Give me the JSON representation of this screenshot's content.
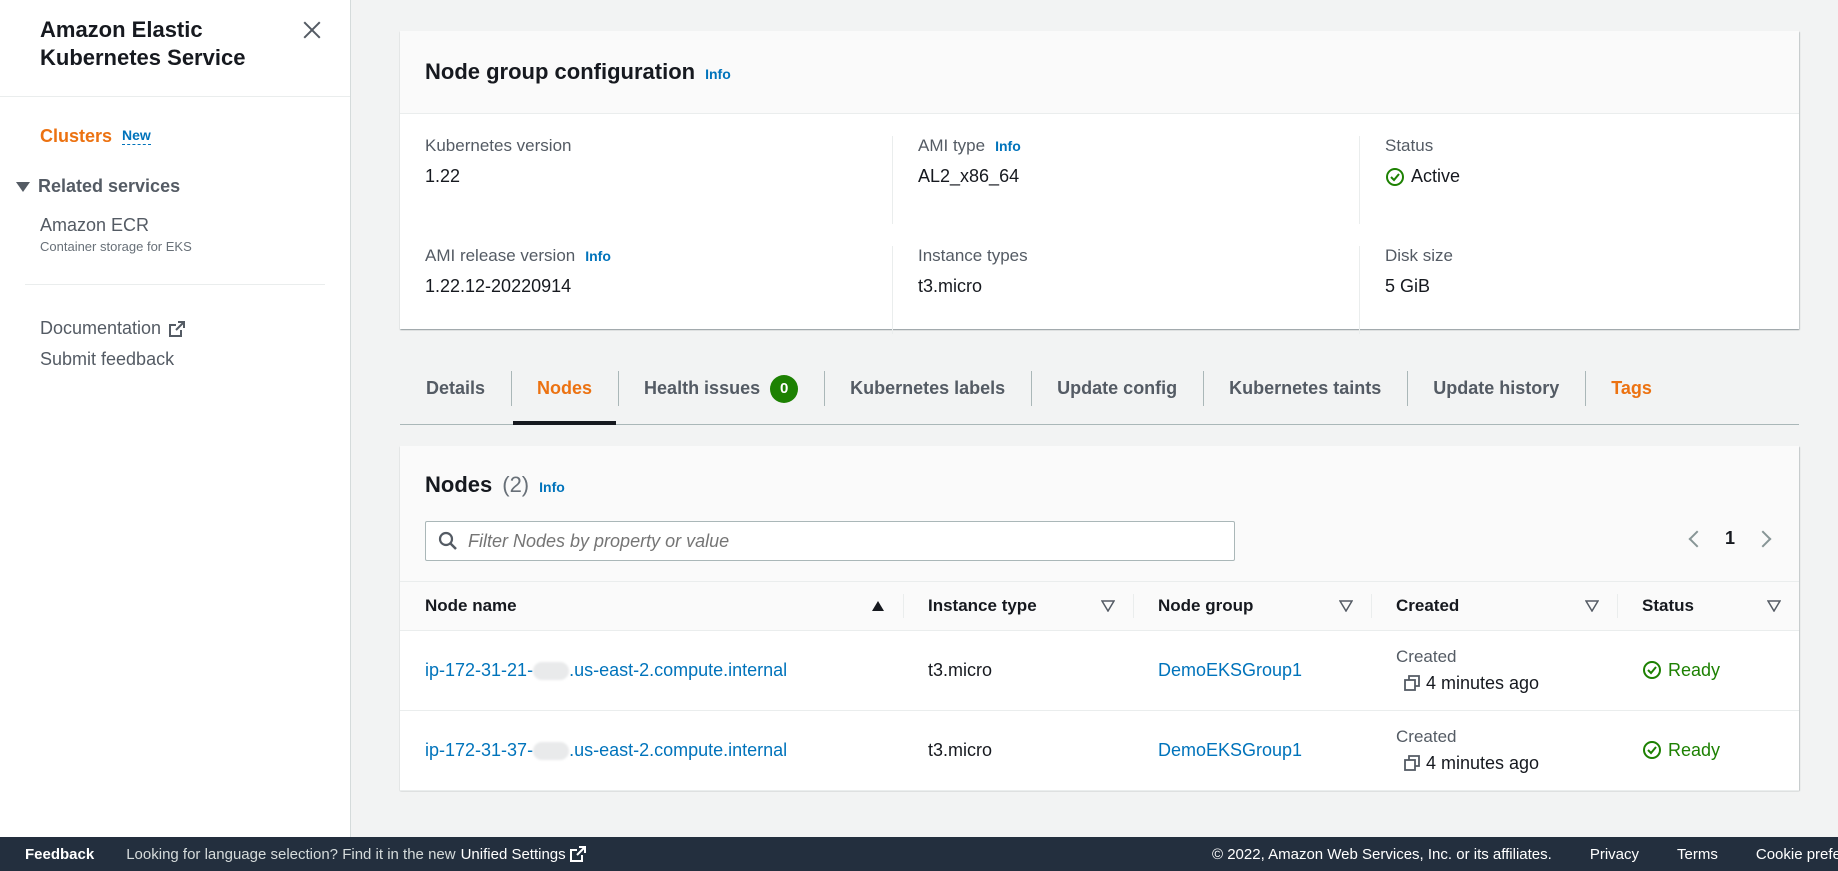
{
  "sidebar": {
    "title": "Amazon Elastic Kubernetes Service",
    "clusters_label": "Clusters",
    "clusters_badge": "New",
    "related_label": "Related services",
    "ecr_title": "Amazon ECR",
    "ecr_sub": "Container storage for EKS",
    "documentation": "Documentation",
    "feedback": "Submit feedback"
  },
  "config": {
    "title": "Node group configuration",
    "info": "Info",
    "k8s_version_label": "Kubernetes version",
    "k8s_version": "1.22",
    "ami_type_label": "AMI type",
    "ami_type": "AL2_x86_64",
    "status_label": "Status",
    "status": "Active",
    "ami_release_label": "AMI release version",
    "ami_release": "1.22.12-20220914",
    "instance_types_label": "Instance types",
    "instance_types": "t3.micro",
    "disk_size_label": "Disk size",
    "disk_size": "5 GiB"
  },
  "tabs": [
    {
      "label": "Details"
    },
    {
      "label": "Nodes"
    },
    {
      "label": "Health issues",
      "badge": "0"
    },
    {
      "label": "Kubernetes labels"
    },
    {
      "label": "Update config"
    },
    {
      "label": "Kubernetes taints"
    },
    {
      "label": "Update history"
    },
    {
      "label": "Tags"
    }
  ],
  "nodes": {
    "title": "Nodes",
    "count": "(2)",
    "info": "Info",
    "search_placeholder": "Filter Nodes by property or value",
    "page": "1",
    "columns": [
      "Node name",
      "Instance type",
      "Node group",
      "Created",
      "Status"
    ],
    "rows": [
      {
        "name_a": "ip-172-31-21-",
        "name_b": ".us-east-2.compute.internal",
        "instance": "t3.micro",
        "group": "DemoEKSGroup1",
        "created_label": "Created",
        "created": "4 minutes ago",
        "status": "Ready"
      },
      {
        "name_a": "ip-172-31-37-",
        "name_b": ".us-east-2.compute.internal",
        "instance": "t3.micro",
        "group": "DemoEKSGroup1",
        "created_label": "Created",
        "created": "4 minutes ago",
        "status": "Ready"
      }
    ]
  },
  "footer": {
    "feedback": "Feedback",
    "lang_text": "Looking for language selection? Find it in the new",
    "unified": "Unified Settings",
    "copyright": "© 2022, Amazon Web Services, Inc. or its affiliates.",
    "privacy": "Privacy",
    "terms": "Terms",
    "cookie": "Cookie prefere"
  },
  "colors": {
    "accent": "#ec7211",
    "link": "#0073bb",
    "success": "#1d8102",
    "footer_bg": "#232f3e"
  },
  "icons": [
    "close-icon",
    "caret-down-icon",
    "external-link-icon",
    "check-circle-icon",
    "search-icon",
    "chevron-left-icon",
    "chevron-right-icon",
    "sort-ascending-icon",
    "sort-icon",
    "copy-icon"
  ]
}
